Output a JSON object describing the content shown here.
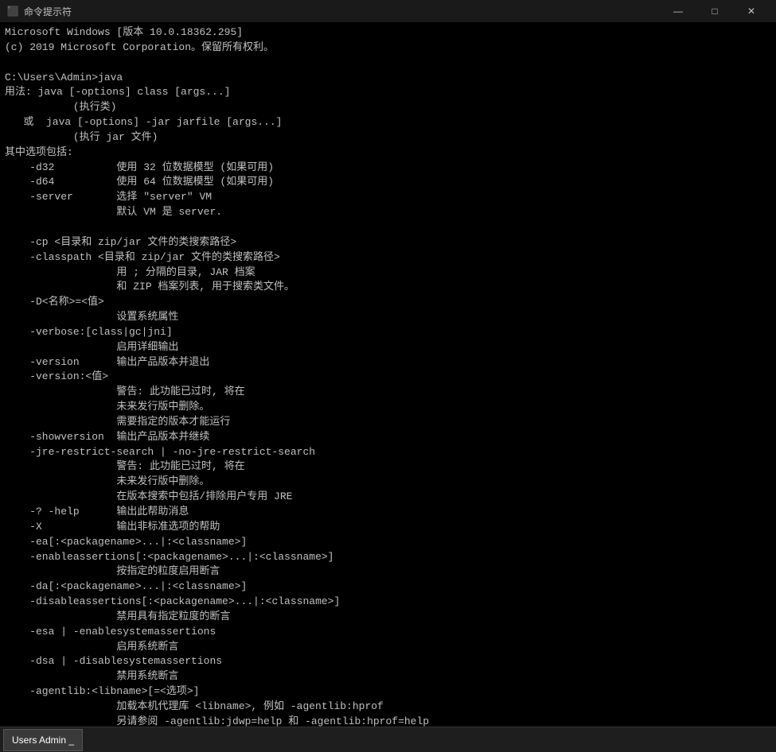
{
  "titlebar": {
    "icon": "⬛",
    "title": "命令提示符",
    "minimize": "—",
    "maximize": "□",
    "close": "✕"
  },
  "console": {
    "content": "Microsoft Windows [版本 10.0.18362.295]\n(c) 2019 Microsoft Corporation。保留所有权利。\n\nC:\\Users\\Admin>java\n用法: java [-options] class [args...]\n           (执行类)\n   或  java [-options] -jar jarfile [args...]\n           (执行 jar 文件)\n其中选项包括:\n    -d32\t  使用 32 位数据模型 (如果可用)\n    -d64\t  使用 64 位数据模型 (如果可用)\n    -server\t  选择 \"server\" VM\n\t\t  默认 VM 是 server.\n\n    -cp <目录和 zip/jar 文件的类搜索路径>\n    -classpath <目录和 zip/jar 文件的类搜索路径>\n                  用 ; 分隔的目录, JAR 档案\n                  和 ZIP 档案列表, 用于搜索类文件。\n    -D<名称>=<值>\n                  设置系统属性\n    -verbose:[class|gc|jni]\n                  启用详细输出\n    -version      输出产品版本并退出\n    -version:<值>\n                  警告: 此功能已过时, 将在\n                  未来发行版中删除。\n                  需要指定的版本才能运行\n    -showversion  输出产品版本并继续\n    -jre-restrict-search | -no-jre-restrict-search\n                  警告: 此功能已过时, 将在\n                  未来发行版中删除。\n                  在版本搜索中包括/排除用户专用 JRE\n    -? -help      输出此帮助消息\n    -X            输出非标准选项的帮助\n    -ea[:<packagename>...|:<classname>]\n    -enableassertions[:<packagename>...|:<classname>]\n                  按指定的粒度启用断言\n    -da[:<packagename>...|:<classname>]\n    -disableassertions[:<packagename>...|:<classname>]\n                  禁用具有指定粒度的断言\n    -esa | -enablesystemassertions\n                  启用系统断言\n    -dsa | -disablesystemassertions\n                  禁用系统断言\n    -agentlib:<libname>[=<选项>]\n                  加载本机代理库 <libname>, 例如 -agentlib:hprof\n                  另请参阅 -agentlib:jdwp=help 和 -agentlib:hprof=help\n    -agentpath:<pathname>[=<选项>]\n                  按完整路径名加载本机代理库\n    -javaagent:<jarpath>[=<选项>]\n                  加载 Java 编程语言代理, 请参阅 java.lang.instrument\n    -splash:<imagepath>\n                  使用指定的图像显示启动屏幕\n有关详细信息, 请参阅 http://www.oracle.com/technetwork/java/javase/documentation/index.html。\n\nC:\\Users\\Admin>_"
  },
  "taskbar": {
    "item_label": "Users Admin  _"
  }
}
